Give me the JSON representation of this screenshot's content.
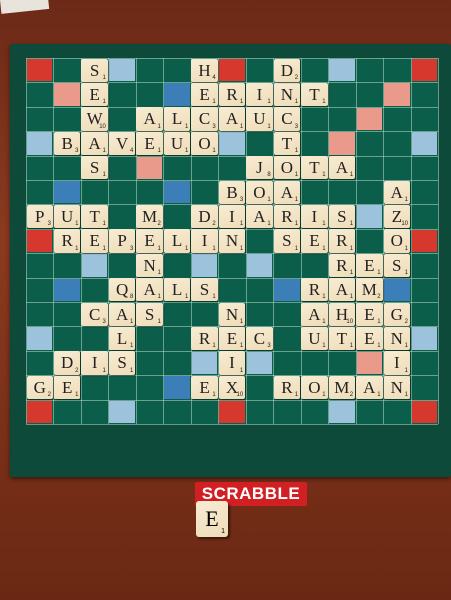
{
  "brand": {
    "logo_text": "SCRABBLE",
    "logo_color": "#d21f24"
  },
  "colors": {
    "board": "#0b5e4a",
    "triple_word": "#d6382e",
    "double_word": "#e99a8a",
    "triple_letter": "#3c7fb8",
    "double_letter": "#9cc2dc",
    "tile": "#f3e3c4"
  },
  "grid": {
    "rows": 15,
    "cols": 15
  },
  "tiles": [
    {
      "r": 0,
      "c": 6,
      "l": "H",
      "p": "4"
    },
    {
      "r": 1,
      "c": 6,
      "l": "E",
      "p": "1"
    },
    {
      "r": 1,
      "c": 7,
      "l": "R",
      "p": "1"
    },
    {
      "r": 1,
      "c": 8,
      "l": "I",
      "p": "1"
    },
    {
      "r": 1,
      "c": 9,
      "l": "N",
      "p": "1"
    },
    {
      "r": 1,
      "c": 10,
      "l": "T",
      "p": "1"
    },
    {
      "r": 0,
      "c": 9,
      "l": "D",
      "p": "2"
    },
    {
      "r": 0,
      "c": 2,
      "l": "S",
      "p": "1"
    },
    {
      "r": 1,
      "c": 2,
      "l": "E",
      "p": "1"
    },
    {
      "r": 2,
      "c": 2,
      "l": "W",
      "p": "10"
    },
    {
      "r": 2,
      "c": 4,
      "l": "A",
      "p": "1"
    },
    {
      "r": 2,
      "c": 5,
      "l": "L",
      "p": "1"
    },
    {
      "r": 2,
      "c": 6,
      "l": "C",
      "p": "3"
    },
    {
      "r": 2,
      "c": 7,
      "l": "A",
      "p": "1"
    },
    {
      "r": 2,
      "c": 8,
      "l": "U",
      "p": "1"
    },
    {
      "r": 2,
      "c": 9,
      "l": "C",
      "p": "3"
    },
    {
      "r": 3,
      "c": 9,
      "l": "T",
      "p": "1"
    },
    {
      "r": 3,
      "c": 1,
      "l": "B",
      "p": "3"
    },
    {
      "r": 3,
      "c": 2,
      "l": "A",
      "p": "1"
    },
    {
      "r": 3,
      "c": 3,
      "l": "V",
      "p": "4"
    },
    {
      "r": 3,
      "c": 4,
      "l": "E",
      "p": "1"
    },
    {
      "r": 3,
      "c": 5,
      "l": "U",
      "p": "1"
    },
    {
      "r": 3,
      "c": 6,
      "l": "O",
      "p": "1"
    },
    {
      "r": 4,
      "c": 2,
      "l": "S",
      "p": "1"
    },
    {
      "r": 4,
      "c": 8,
      "l": "J",
      "p": "8"
    },
    {
      "r": 4,
      "c": 9,
      "l": "O",
      "p": "1"
    },
    {
      "r": 4,
      "c": 10,
      "l": "T",
      "p": "1"
    },
    {
      "r": 4,
      "c": 11,
      "l": "A",
      "p": "1"
    },
    {
      "r": 5,
      "c": 7,
      "l": "B",
      "p": "3"
    },
    {
      "r": 5,
      "c": 8,
      "l": "O",
      "p": "1"
    },
    {
      "r": 5,
      "c": 9,
      "l": "A",
      "p": "1"
    },
    {
      "r": 5,
      "c": 13,
      "l": "A",
      "p": "1"
    },
    {
      "r": 6,
      "c": 0,
      "l": "P",
      "p": "3"
    },
    {
      "r": 6,
      "c": 1,
      "l": "U",
      "p": "1"
    },
    {
      "r": 6,
      "c": 2,
      "l": "T",
      "p": "1"
    },
    {
      "r": 6,
      "c": 4,
      "l": "M",
      "p": "2"
    },
    {
      "r": 6,
      "c": 6,
      "l": "D",
      "p": "2"
    },
    {
      "r": 6,
      "c": 7,
      "l": "I",
      "p": "1"
    },
    {
      "r": 6,
      "c": 8,
      "l": "A",
      "p": "1"
    },
    {
      "r": 6,
      "c": 9,
      "l": "R",
      "p": "1"
    },
    {
      "r": 6,
      "c": 10,
      "l": "I",
      "p": "1"
    },
    {
      "r": 6,
      "c": 11,
      "l": "S",
      "p": "1"
    },
    {
      "r": 6,
      "c": 13,
      "l": "Z",
      "p": "10"
    },
    {
      "r": 7,
      "c": 1,
      "l": "R",
      "p": "1"
    },
    {
      "r": 7,
      "c": 2,
      "l": "E",
      "p": "1"
    },
    {
      "r": 7,
      "c": 3,
      "l": "P",
      "p": "3"
    },
    {
      "r": 7,
      "c": 4,
      "l": "E",
      "p": "1"
    },
    {
      "r": 7,
      "c": 5,
      "l": "L",
      "p": "1"
    },
    {
      "r": 7,
      "c": 6,
      "l": "I",
      "p": "1"
    },
    {
      "r": 7,
      "c": 7,
      "l": "N",
      "p": "1"
    },
    {
      "r": 7,
      "c": 9,
      "l": "S",
      "p": "1"
    },
    {
      "r": 7,
      "c": 10,
      "l": "E",
      "p": "1"
    },
    {
      "r": 7,
      "c": 11,
      "l": "R",
      "p": "1"
    },
    {
      "r": 7,
      "c": 13,
      "l": "O",
      "p": "1"
    },
    {
      "r": 8,
      "c": 4,
      "l": "N",
      "p": "1"
    },
    {
      "r": 8,
      "c": 11,
      "l": "R",
      "p": "1"
    },
    {
      "r": 8,
      "c": 12,
      "l": "E",
      "p": "1"
    },
    {
      "r": 8,
      "c": 13,
      "l": "S",
      "p": "1"
    },
    {
      "r": 9,
      "c": 3,
      "l": "Q",
      "p": "8"
    },
    {
      "r": 9,
      "c": 4,
      "l": "A",
      "p": "1"
    },
    {
      "r": 9,
      "c": 5,
      "l": "L",
      "p": "1"
    },
    {
      "r": 9,
      "c": 6,
      "l": "S",
      "p": "1"
    },
    {
      "r": 9,
      "c": 10,
      "l": "R",
      "p": "1"
    },
    {
      "r": 9,
      "c": 11,
      "l": "A",
      "p": "1"
    },
    {
      "r": 9,
      "c": 12,
      "l": "M",
      "p": "2"
    },
    {
      "r": 10,
      "c": 2,
      "l": "C",
      "p": "3"
    },
    {
      "r": 10,
      "c": 3,
      "l": "A",
      "p": "1"
    },
    {
      "r": 10,
      "c": 4,
      "l": "S",
      "p": "1"
    },
    {
      "r": 10,
      "c": 7,
      "l": "N",
      "p": "1"
    },
    {
      "r": 10,
      "c": 10,
      "l": "A",
      "p": "1"
    },
    {
      "r": 10,
      "c": 11,
      "l": "H",
      "p": "10"
    },
    {
      "r": 10,
      "c": 12,
      "l": "E",
      "p": "1"
    },
    {
      "r": 10,
      "c": 13,
      "l": "G",
      "p": "2"
    },
    {
      "r": 11,
      "c": 3,
      "l": "L",
      "p": "1"
    },
    {
      "r": 11,
      "c": 6,
      "l": "R",
      "p": "1"
    },
    {
      "r": 11,
      "c": 7,
      "l": "E",
      "p": "1"
    },
    {
      "r": 11,
      "c": 8,
      "l": "C",
      "p": "3"
    },
    {
      "r": 11,
      "c": 10,
      "l": "U",
      "p": "1"
    },
    {
      "r": 11,
      "c": 11,
      "l": "T",
      "p": "1"
    },
    {
      "r": 11,
      "c": 12,
      "l": "E",
      "p": "1"
    },
    {
      "r": 11,
      "c": 13,
      "l": "N",
      "p": "1"
    },
    {
      "r": 12,
      "c": 1,
      "l": "D",
      "p": "2"
    },
    {
      "r": 12,
      "c": 2,
      "l": "I",
      "p": "1"
    },
    {
      "r": 12,
      "c": 3,
      "l": "S",
      "p": "1"
    },
    {
      "r": 12,
      "c": 7,
      "l": "I",
      "p": "1"
    },
    {
      "r": 12,
      "c": 13,
      "l": "I",
      "p": "1"
    },
    {
      "r": 13,
      "c": 0,
      "l": "G",
      "p": "2"
    },
    {
      "r": 13,
      "c": 1,
      "l": "E",
      "p": "1"
    },
    {
      "r": 13,
      "c": 6,
      "l": "E",
      "p": "1"
    },
    {
      "r": 13,
      "c": 7,
      "l": "X",
      "p": "10"
    },
    {
      "r": 13,
      "c": 9,
      "l": "R",
      "p": "1"
    },
    {
      "r": 13,
      "c": 10,
      "l": "O",
      "p": "1"
    },
    {
      "r": 13,
      "c": 11,
      "l": "M",
      "p": "2"
    },
    {
      "r": 13,
      "c": 12,
      "l": "A",
      "p": "1"
    },
    {
      "r": 13,
      "c": 13,
      "l": "N",
      "p": "1"
    }
  ],
  "loose_tile": {
    "letter": "E",
    "points": "1"
  }
}
